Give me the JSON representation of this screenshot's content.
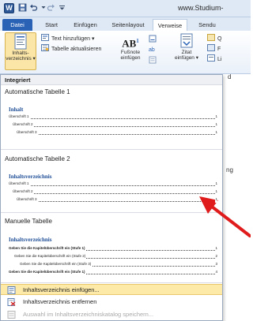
{
  "titlebar": {
    "app_icon_letter": "W",
    "window_title": "www.Studium-"
  },
  "tabs": [
    {
      "label": "Datei"
    },
    {
      "label": "Start"
    },
    {
      "label": "Einfügen"
    },
    {
      "label": "Seitenlayout"
    },
    {
      "label": "Verweise"
    },
    {
      "label": "Sendu"
    }
  ],
  "ribbon": {
    "toc_button": "Inhalts-",
    "toc_button_line2": "verzeichnis ▾",
    "add_text": "Text hinzufügen ▾",
    "update_table": "Tabelle aktualisieren",
    "footnote_line1": "Fußnote",
    "footnote_line2": "einfügen",
    "footnote_glyph": "AB",
    "footnote_sup": "1",
    "citation_line1": "Zitat",
    "citation_line2": "einfügen ▾",
    "cut_q": "Q",
    "cut_f": "F",
    "cut_li": "Li"
  },
  "doc_fragments": {
    "frag_d": "d",
    "frag_ng": "ng"
  },
  "dropdown": {
    "section_builtin": "Integriert",
    "auto_table_1": {
      "title": "Automatische Tabelle 1",
      "heading": "Inhalt",
      "entries": [
        {
          "label": "Überschrift 1",
          "page": "1"
        },
        {
          "label": "Überschrift 2",
          "page": "1"
        },
        {
          "label": "Überschrift 3",
          "page": "1"
        }
      ]
    },
    "auto_table_2": {
      "title": "Automatische Tabelle 2",
      "heading": "Inhaltsverzeichnis",
      "entries": [
        {
          "label": "Überschrift 1",
          "page": "1"
        },
        {
          "label": "Überschrift 2",
          "page": "1"
        },
        {
          "label": "Überschrift 3",
          "page": "1"
        }
      ]
    },
    "manual_table": {
      "title": "Manuelle Tabelle",
      "heading": "Inhaltsverzeichnis",
      "entries": [
        {
          "label": "Geben Sie die Kapitelüberschrift ein (Stufe 1)",
          "page": "1"
        },
        {
          "label": "Geben Sie die Kapitelüberschrift ein (Stufe 2)",
          "page": "2"
        },
        {
          "label": "Geben Sie die Kapitelüberschrift ein (Stufe 3)",
          "page": "3"
        },
        {
          "label": "Geben Sie die Kapitelüberschrift ein (Stufe 1)",
          "page": "4"
        }
      ]
    },
    "menu_items": [
      {
        "label": "Inhaltsverzeichnis einfügen...",
        "enabled": true,
        "highlighted": true
      },
      {
        "label": "Inhaltsverzeichnis entfernen",
        "enabled": true,
        "highlighted": false
      },
      {
        "label": "Auswahl im Inhaltsverzeichniskatalog speichern...",
        "enabled": false,
        "highlighted": false
      }
    ]
  },
  "colors": {
    "file_tab": "#2a62b6",
    "toc_heading": "#1f4e96",
    "highlight": "#fdeaa8",
    "arrow": "#e01b1b"
  }
}
